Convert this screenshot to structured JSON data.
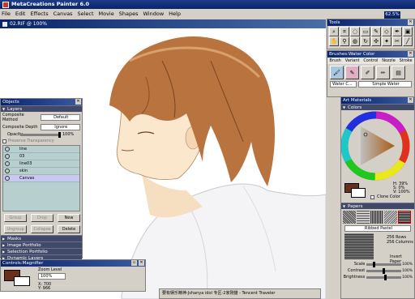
{
  "app": {
    "title": "MetaCreations Painter 6.0",
    "zoom_badge": "62.5%"
  },
  "menu": [
    "File",
    "Edit",
    "Effects",
    "Canvas",
    "Select",
    "Movie",
    "Shapes",
    "Window",
    "Help"
  ],
  "document": {
    "title": "02.RIF @ 100%"
  },
  "tools": {
    "title": "Tools"
  },
  "brushes": {
    "title": "Brushes:Water Color",
    "menus": [
      "Brush",
      "Variant",
      "Control",
      "Nozzle",
      "Stroke"
    ],
    "variant_left": "Water C...",
    "variant_right": "Simple Water"
  },
  "objects": {
    "title": "Objects",
    "layers_header": "Layers",
    "composite_method_label": "Composite Method",
    "composite_method_value": "Default",
    "composite_depth_label": "Composite Depth",
    "composite_depth_value": "Ignore",
    "opacity_label": "Opacity",
    "opacity_value": "100%",
    "preserve_label": "Preserve Transparency",
    "layers": [
      "line",
      "03",
      "line03",
      "skin",
      "Canvas"
    ],
    "buttons": [
      "Group",
      "Drop",
      "New",
      "Ungroup",
      "Collapse",
      "Delete"
    ],
    "sections": [
      "Masks",
      "Image Portfolio",
      "Selection Portfolio",
      "Dynamic Layers"
    ]
  },
  "magnifier": {
    "title": "Controls:Magnifier",
    "zoom_label": "Zoom Level",
    "zoom_value": "100%",
    "x_label": "X: 700",
    "y_label": "Y: 966"
  },
  "art_materials": {
    "title": "Art Materials",
    "colors_header": "Colors",
    "hue": "H: 39%",
    "sat": "S: 0%",
    "val": "V: 100%",
    "clone_label": "Clone Color",
    "papers_header": "Papers",
    "paper_name": "Ribbed Pastel",
    "rows": "256 Rows",
    "cols": "256 Columns",
    "invert_label": "Invert Paper",
    "scale_label": "Scale",
    "contrast_label": "Contrast",
    "brightness_label": "Brightness",
    "scale_value": "100%",
    "contrast_value": "100%",
    "brightness_value": "100%",
    "main_color": "#6a2f1a",
    "secondary_color": "#ffffff"
  },
  "taskbar": {
    "text": "要有娱乐精神-Jshanya idol 专区-2家刚猫 - Tencent Traveler"
  }
}
